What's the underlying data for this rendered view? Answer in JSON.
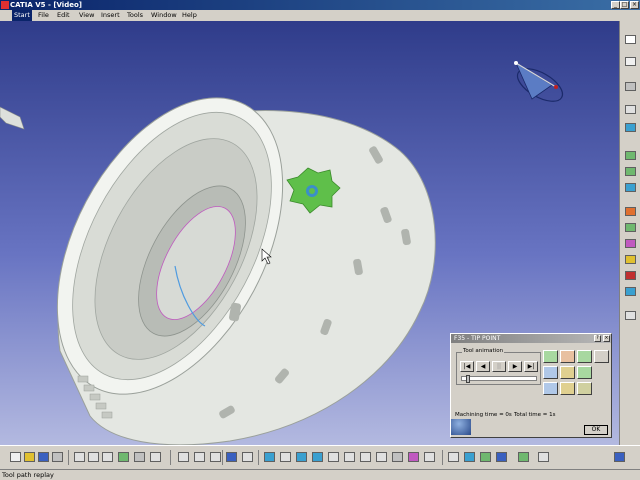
{
  "window": {
    "title": "CATIA V5 - [Video]",
    "min_glyph": "_",
    "max_glyph": "□",
    "close_glyph": "×"
  },
  "menu": [
    "Start",
    "File",
    "Edit",
    "View",
    "Insert",
    "Tools",
    "Window",
    "Help"
  ],
  "viewport": {
    "background_top": "#2f3c8a",
    "background_bottom": "#b3b9e0",
    "part_color": "#eef0ec",
    "tool_color": "#5fbf4a"
  },
  "dialog": {
    "title": "F35 - TIP POINT",
    "help_glyph": "?",
    "close_glyph": "×",
    "group_label": "Tool animation",
    "player": [
      "|◀",
      "◀",
      "||",
      "▶",
      "▶|"
    ],
    "animation_progress": 0.05,
    "machining_time": "Machining time = 0s",
    "total_time": "Total time = 1s",
    "ok_label": "OK"
  },
  "status": {
    "text": "Tool path replay"
  }
}
